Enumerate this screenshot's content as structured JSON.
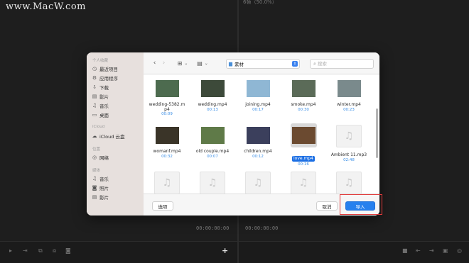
{
  "watermark": "www.MacW.com",
  "background": {
    "top_right_label": "6帧（50.0%）",
    "timecode_left": "00:00:00:00",
    "timecode_right": "00:00:00:00",
    "plus_symbol": "+"
  },
  "sidebar": {
    "favorites_title": "个人收藏",
    "favorites": [
      {
        "icon": "clock-icon",
        "glyph": "◷",
        "label": "最近项目"
      },
      {
        "icon": "app-icon",
        "glyph": "⚙",
        "label": "应用程序"
      },
      {
        "icon": "download-icon",
        "glyph": "⇩",
        "label": "下载"
      },
      {
        "icon": "movie-icon",
        "glyph": "▤",
        "label": "影片"
      },
      {
        "icon": "music-icon",
        "glyph": "♫",
        "label": "音乐"
      },
      {
        "icon": "desktop-icon",
        "glyph": "▭",
        "label": "桌面"
      }
    ],
    "icloud_title": "iCloud",
    "icloud": [
      {
        "icon": "cloud-icon",
        "glyph": "☁",
        "label": "iCloud 云盘"
      }
    ],
    "locations_title": "位置",
    "locations": [
      {
        "icon": "network-icon",
        "glyph": "◎",
        "label": "网络"
      }
    ],
    "media_title": "媒体",
    "media": [
      {
        "icon": "music-icon",
        "glyph": "♫",
        "label": "音乐"
      },
      {
        "icon": "photo-icon",
        "glyph": "◙",
        "label": "照片"
      },
      {
        "icon": "movie-icon",
        "glyph": "▤",
        "label": "影片"
      }
    ]
  },
  "toolbar": {
    "back_glyph": "‹",
    "forward_glyph": "›",
    "grid_view_glyph": "⊞",
    "list_view_glyph": "▤",
    "chevron_glyph": "⌄",
    "folder_glyph": "▆",
    "folder_name": "素材",
    "select_arrows": "⇕",
    "search_glyph": "⌕",
    "search_placeholder": "搜索"
  },
  "files": [
    {
      "name": "wedding-5382.mp4",
      "duration": "00:09",
      "type": "video",
      "color": "#4d6b4f",
      "selected": false
    },
    {
      "name": "wedding.mp4",
      "duration": "00:13",
      "type": "video",
      "color": "#3d4a3a",
      "selected": false
    },
    {
      "name": "joining.mp4",
      "duration": "00:17",
      "type": "video",
      "color": "#8fb7d4",
      "selected": false
    },
    {
      "name": "smoke.mp4",
      "duration": "00:30",
      "type": "video",
      "color": "#5b6b58",
      "selected": false
    },
    {
      "name": "winter.mp4",
      "duration": "00:23",
      "type": "video",
      "color": "#7a8a8c",
      "selected": false
    },
    {
      "name": "womanf.mp4",
      "duration": "00:32",
      "type": "video",
      "color": "#3a3428",
      "selected": false
    },
    {
      "name": "old couple.mp4",
      "duration": "00:07",
      "type": "video",
      "color": "#5f7a48",
      "selected": false
    },
    {
      "name": "children.mp4",
      "duration": "00:12",
      "type": "video",
      "color": "#3b3f5c",
      "selected": false
    },
    {
      "name": "love.mp4",
      "duration": "00:16",
      "type": "video",
      "color": "#6b4a30",
      "selected": true
    },
    {
      "name": "Ambient 11.mp3",
      "duration": "02:48",
      "type": "audio",
      "color": "#f2f2f2",
      "selected": false
    },
    {
      "name": "",
      "duration": "",
      "type": "audio",
      "color": "#f2f2f2",
      "selected": false
    },
    {
      "name": "",
      "duration": "",
      "type": "audio",
      "color": "#f2f2f2",
      "selected": false
    },
    {
      "name": "",
      "duration": "",
      "type": "audio",
      "color": "#f2f2f2",
      "selected": false
    },
    {
      "name": "",
      "duration": "",
      "type": "audio",
      "color": "#f2f2f2",
      "selected": false
    },
    {
      "name": "",
      "duration": "",
      "type": "audio",
      "color": "#f2f2f2",
      "selected": false
    }
  ],
  "footer": {
    "options_label": "选项",
    "cancel_label": "取消",
    "import_label": "导入"
  },
  "colors": {
    "accent": "#2680ee",
    "highlight_box": "#e23b3b"
  }
}
